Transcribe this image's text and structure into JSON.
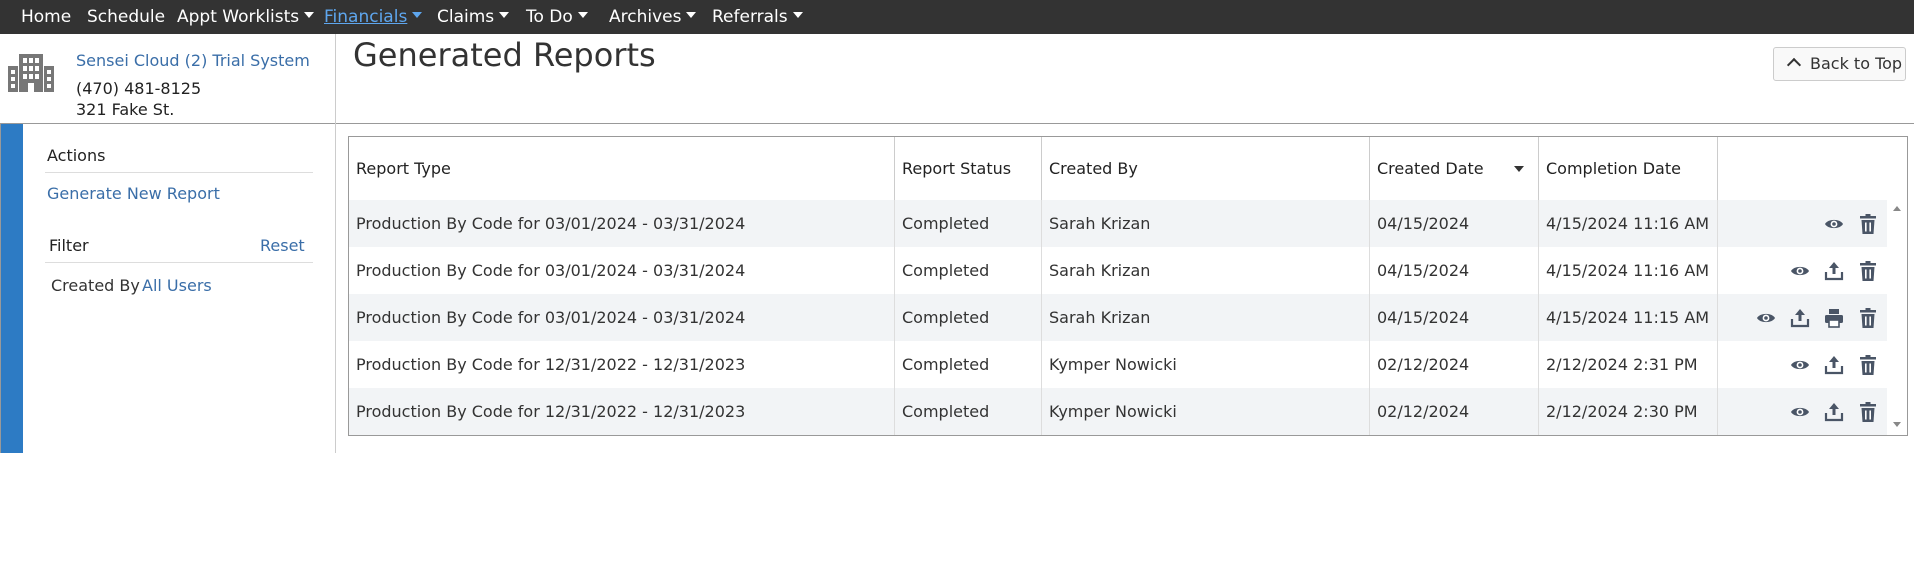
{
  "nav": {
    "items": [
      {
        "label": "Home",
        "caret": false,
        "active": false
      },
      {
        "label": "Schedule",
        "caret": false,
        "active": false
      },
      {
        "label": "Appt Worklists",
        "caret": true,
        "active": false
      },
      {
        "label": "Financials",
        "caret": true,
        "active": true
      },
      {
        "label": "Claims",
        "caret": true,
        "active": false
      },
      {
        "label": "To Do",
        "caret": true,
        "active": false
      },
      {
        "label": "Archives",
        "caret": true,
        "active": false
      },
      {
        "label": "Referrals",
        "caret": true,
        "active": false
      }
    ]
  },
  "practice": {
    "name": "Sensei Cloud (2) Trial System",
    "phone": "(470) 481-8125",
    "address": "321 Fake St.",
    "icon": "building-icon"
  },
  "page": {
    "title": "Generated Reports",
    "back_to_top": "Back to Top"
  },
  "sidebar": {
    "actions_title": "Actions",
    "generate_new_report": "Generate New Report",
    "filter_title": "Filter",
    "reset": "Reset",
    "created_by_label": "Created By",
    "created_by_value": "All Users"
  },
  "table": {
    "columns": [
      "Report Type",
      "Report Status",
      "Created By",
      "Created Date",
      "Completion Date",
      ""
    ],
    "sorted_column": "Created Date",
    "rows": [
      {
        "report_type": "Production By Code for 03/01/2024 - 03/31/2024",
        "status": "Completed",
        "created_by": "Sarah Krizan",
        "created_date": "04/15/2024",
        "completion_date": "4/15/2024 11:16 AM",
        "actions": [
          "view",
          "delete"
        ]
      },
      {
        "report_type": "Production By Code for 03/01/2024 - 03/31/2024",
        "status": "Completed",
        "created_by": "Sarah Krizan",
        "created_date": "04/15/2024",
        "completion_date": "4/15/2024 11:16 AM",
        "actions": [
          "view",
          "export",
          "delete"
        ]
      },
      {
        "report_type": "Production By Code for 03/01/2024 - 03/31/2024",
        "status": "Completed",
        "created_by": "Sarah Krizan",
        "created_date": "04/15/2024",
        "completion_date": "4/15/2024 11:15 AM",
        "actions": [
          "view",
          "export",
          "print",
          "delete"
        ]
      },
      {
        "report_type": "Production By Code for 12/31/2022 - 12/31/2023",
        "status": "Completed",
        "created_by": "Kymper Nowicki",
        "created_date": "02/12/2024",
        "completion_date": "2/12/2024 2:31 PM",
        "actions": [
          "view",
          "export",
          "delete"
        ]
      },
      {
        "report_type": "Production By Code for 12/31/2022 - 12/31/2023",
        "status": "Completed",
        "created_by": "Kymper Nowicki",
        "created_date": "02/12/2024",
        "completion_date": "2/12/2024 2:30 PM",
        "actions": [
          "view",
          "export",
          "delete"
        ]
      }
    ]
  },
  "colors": {
    "nav_bg": "#333333",
    "nav_active": "#5ea6ee",
    "link": "#3a6ea8",
    "sidebar_strip": "#2d7bc4",
    "row_alt": "#f2f4f6",
    "icon": "#4a5566"
  }
}
